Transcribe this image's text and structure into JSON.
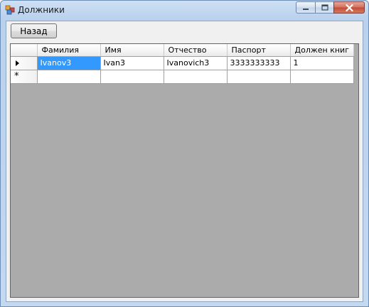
{
  "window": {
    "title": "Должники",
    "buttons": {
      "minimize_icon": "minimize-icon",
      "maximize_icon": "maximize-icon",
      "close_icon": "close-icon"
    }
  },
  "toolbar": {
    "back_label": "Назад"
  },
  "grid": {
    "columns": [
      "Фамилия",
      "Имя",
      "Отчество",
      "Паспорт",
      "Должен книг"
    ],
    "rows": [
      {
        "current": true,
        "cells": [
          "Ivanov3",
          "Ivan3",
          "Ivanovich3",
          "3333333333",
          "1"
        ]
      }
    ],
    "new_row_marker": "*",
    "selection_color": "#3399ff",
    "background_color": "#ababab"
  }
}
